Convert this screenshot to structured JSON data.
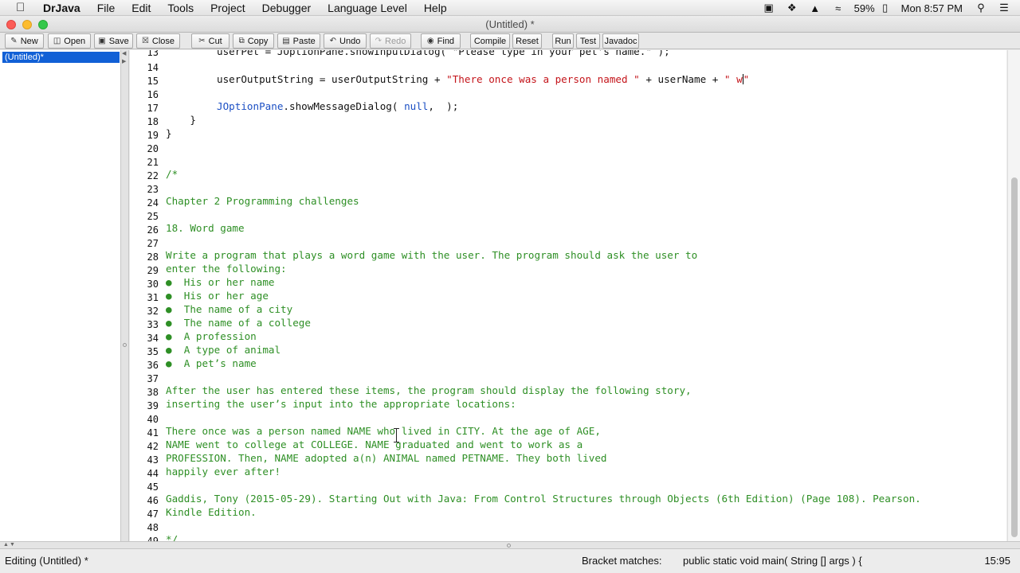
{
  "menubar": {
    "app_name": "DrJava",
    "items": [
      "File",
      "Edit",
      "Tools",
      "Project",
      "Debugger",
      "Language Level",
      "Help"
    ],
    "battery": "59%",
    "clock": "Mon 8:57 PM"
  },
  "window": {
    "title": "(Untitled) *"
  },
  "toolbar": {
    "new": "New",
    "open": "Open",
    "save": "Save",
    "close": "Close",
    "cut": "Cut",
    "copy": "Copy",
    "paste": "Paste",
    "undo": "Undo",
    "redo": "Redo",
    "find": "Find",
    "compile": "Compile",
    "reset": "Reset",
    "run": "Run",
    "test": "Test",
    "javadoc": "Javadoc"
  },
  "documents": {
    "active": "(Untitled)*"
  },
  "editor": {
    "line_numbers": [
      "13",
      "14",
      "15",
      "16",
      "17",
      "18",
      "19",
      "20",
      "21",
      "22",
      "23",
      "24",
      "25",
      "26",
      "27",
      "28",
      "29",
      "30",
      "31",
      "32",
      "33",
      "34",
      "35",
      "36",
      "37",
      "38",
      "39",
      "40",
      "41",
      "42",
      "43",
      "44",
      "45",
      "46",
      "47",
      "48",
      "49"
    ],
    "line13": "userPet = JOptionPane.showInputDialog( \"Please type in your pet's name.\" );",
    "line15": {
      "var": "userOutputString = userOutputString + ",
      "str1": "\"There once was a person named \"",
      "mid": " + userName + ",
      "str2": "\" w",
      "str3": "\""
    },
    "line17": {
      "cls": "JOptionPane",
      "call": ".showMessageDialog( ",
      "null": "null",
      "rest": ",  );"
    },
    "line18": "    }",
    "line19": "}",
    "line22": "/*",
    "line24": "Chapter 2 Programming challenges",
    "line26": "18. Word game",
    "line28": "Write a program that plays a word game with the user. The program should ask the user to",
    "line29": "enter the following:",
    "line30": "●  His or her name",
    "line31": "●  His or her age",
    "line32": "●  The name of a city",
    "line33": "●  The name of a college",
    "line34": "●  A profession",
    "line35": "●  A type of animal",
    "line36": "●  A pet’s name",
    "line38": "After the user has entered these items, the program should display the following story,",
    "line39": "inserting the user’s input into the appropriate locations:",
    "line41": "There once was a person named NAME who lived in CITY. At the age of AGE,",
    "line42": "NAME went to college at COLLEGE. NAME graduated and went to work as a",
    "line43": "PROFESSION. Then, NAME adopted a(n) ANIMAL named PETNAME. They both lived",
    "line44": "happily ever after!",
    "line46": "Gaddis, Tony (2015-05-29). Starting Out with Java: From Control Structures through Objects (6th Edition) (Page 108). Pearson.",
    "line47": "Kindle Edition.",
    "line49": "*/"
  },
  "statusbar": {
    "editing": "Editing (Untitled) *",
    "bracket_label": "Bracket matches:",
    "bracket_value": "public static void main( String [] args ) {",
    "position": "15:95"
  }
}
